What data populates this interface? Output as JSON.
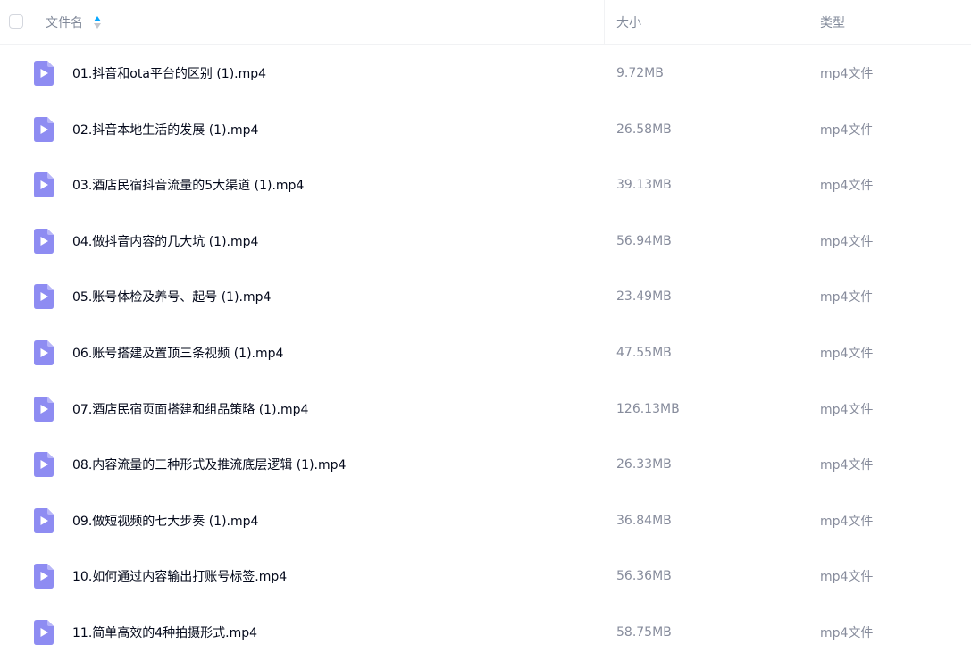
{
  "header": {
    "name_label": "文件名",
    "size_label": "大小",
    "type_label": "类型",
    "sort_icon": "sort-ascending-icon"
  },
  "colors": {
    "icon_fill": "#8e8cf2",
    "sort_active": "#06a7ff"
  },
  "files": [
    {
      "name": "01.抖音和ota平台的区别 (1).mp4",
      "size": "9.72MB",
      "type": "mp4文件",
      "icon": "video-file-icon"
    },
    {
      "name": "02.抖音本地生活的发展 (1).mp4",
      "size": "26.58MB",
      "type": "mp4文件",
      "icon": "video-file-icon"
    },
    {
      "name": "03.酒店民宿抖音流量的5大渠道 (1).mp4",
      "size": "39.13MB",
      "type": "mp4文件",
      "icon": "video-file-icon"
    },
    {
      "name": "04.做抖音内容的几大坑 (1).mp4",
      "size": "56.94MB",
      "type": "mp4文件",
      "icon": "video-file-icon"
    },
    {
      "name": "05.账号体检及养号、起号 (1).mp4",
      "size": "23.49MB",
      "type": "mp4文件",
      "icon": "video-file-icon"
    },
    {
      "name": "06.账号搭建及置顶三条视频 (1).mp4",
      "size": "47.55MB",
      "type": "mp4文件",
      "icon": "video-file-icon"
    },
    {
      "name": "07.酒店民宿页面搭建和组品策略 (1).mp4",
      "size": "126.13MB",
      "type": "mp4文件",
      "icon": "video-file-icon"
    },
    {
      "name": "08.内容流量的三种形式及推流底层逻辑 (1).mp4",
      "size": "26.33MB",
      "type": "mp4文件",
      "icon": "video-file-icon"
    },
    {
      "name": "09.做短视频的七大步奏 (1).mp4",
      "size": "36.84MB",
      "type": "mp4文件",
      "icon": "video-file-icon"
    },
    {
      "name": "10.如何通过内容输出打账号标签.mp4",
      "size": "56.36MB",
      "type": "mp4文件",
      "icon": "video-file-icon"
    },
    {
      "name": "11.简单高效的4种拍摄形式.mp4",
      "size": "58.75MB",
      "type": "mp4文件",
      "icon": "video-file-icon"
    }
  ]
}
